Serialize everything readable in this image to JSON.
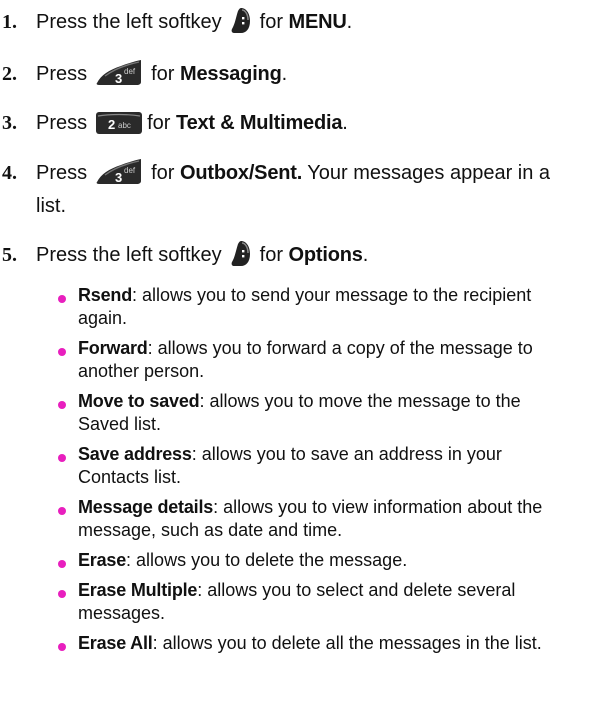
{
  "steps": [
    {
      "num": "1.",
      "pre": "Press the left softkey",
      "mid": "for",
      "bold": "MENU",
      "post": ".",
      "key_icon": "softkey-left-icon"
    },
    {
      "num": "2.",
      "pre": "Press",
      "mid": "for",
      "bold": "Messaging",
      "post": ".",
      "key_icon": "key-3-def-icon"
    },
    {
      "num": "3.",
      "pre": "Press",
      "mid": "for",
      "bold": "Text & Multimedia",
      "post": ".",
      "key_icon": "key-2-abc-icon"
    },
    {
      "num": "4.",
      "pre": "Press",
      "mid": "for",
      "bold": "Outbox/Sent.",
      "post": "Your messages appear in a",
      "post2": "list.",
      "key_icon": "key-3-def-icon"
    },
    {
      "num": "5.",
      "pre": "Press the left softkey",
      "mid": "for",
      "bold": "Options",
      "post": ".",
      "key_icon": "softkey-left-icon"
    }
  ],
  "keys": {
    "key3_digit": "3",
    "key3_letters": "def",
    "key2_digit": "2",
    "key2_letters": "abc"
  },
  "options": [
    {
      "term": "Rsend",
      "text": ": allows you to send your message to the recipient",
      "text2": "again."
    },
    {
      "term": "Forward",
      "text": ": allows you to forward a copy of the message to",
      "text2": "another person."
    },
    {
      "term": "Move to saved",
      "text": ": allows you to move the message to the",
      "text2": "Saved list."
    },
    {
      "term": "Save address",
      "text": ": allows you to save an address in your",
      "text2": "Contacts list."
    },
    {
      "term": "Message details",
      "text": ": allows you to view information about the",
      "text2": "message, such as date and time."
    },
    {
      "term": "Erase",
      "text": ": allows you to delete the message.",
      "text2": ""
    },
    {
      "term": "Erase Multiple",
      "text": ": allows you to select and delete several",
      "text2": "messages."
    },
    {
      "term": "Erase All",
      "text": ": allows you to delete all the messages in the list.",
      "text2": ""
    }
  ],
  "colors": {
    "bullet": "#e81fbe",
    "key_bg": "#2a2a2a"
  }
}
